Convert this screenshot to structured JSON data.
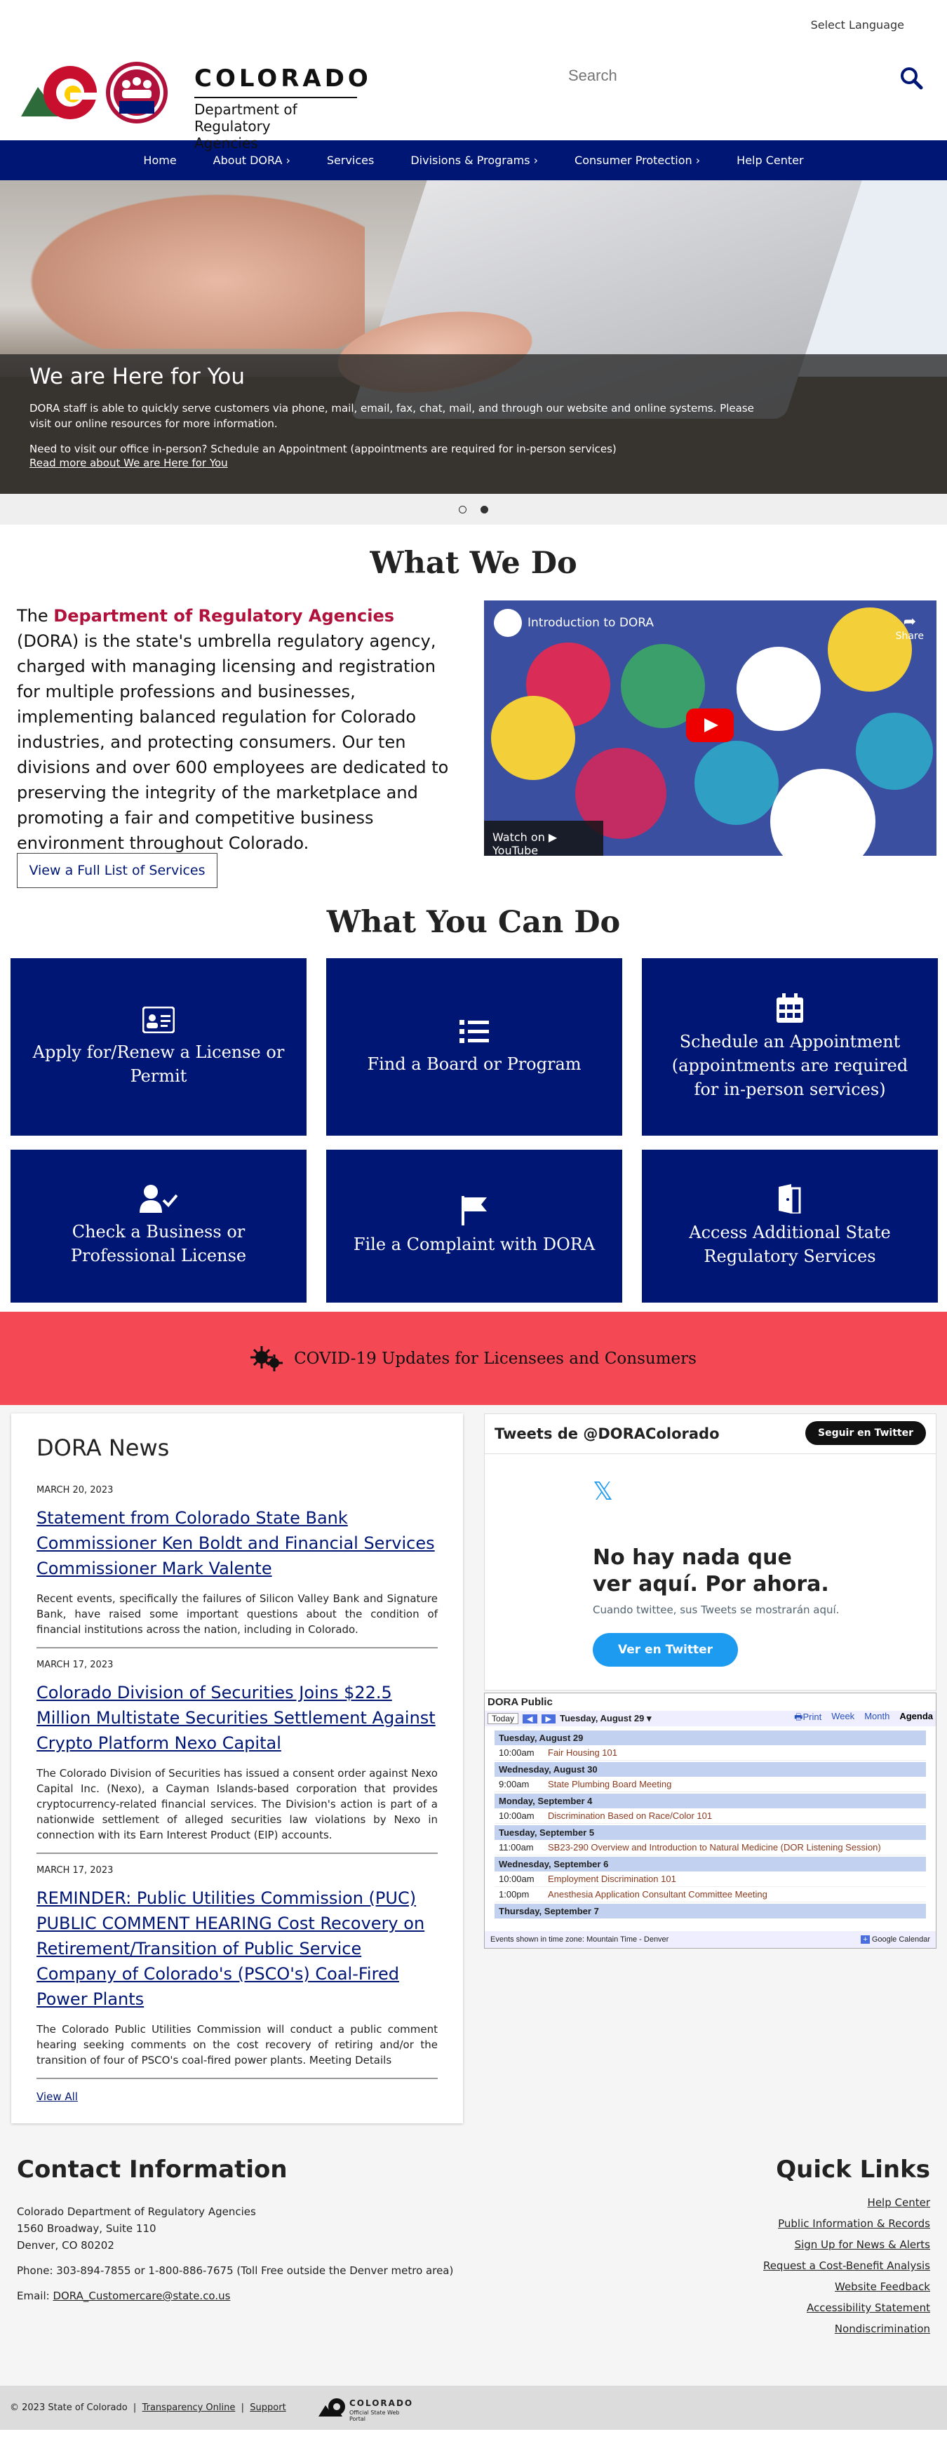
{
  "top": {
    "language": "Select Language"
  },
  "header": {
    "state_word": "COLORADO",
    "dept_line1": "Department of",
    "dept_line2": "Regulatory Agencies",
    "seal_text": "DORA",
    "search_placeholder": "Search"
  },
  "nav": {
    "items": [
      "Home",
      "About DORA ›",
      "Services",
      "Divisions & Programs ›",
      "Consumer Protection ›",
      "Help Center"
    ]
  },
  "hero": {
    "title": "We are Here for You",
    "para1": "DORA staff is able to quickly serve customers via phone, mail, email, fax, chat, mail, and through our website and online systems. Please visit our online resources for more information.",
    "para2": "Need to visit our office in-person? Schedule an Appointment (appointments are required for in-person services)",
    "link": "Read more about We are Here for You"
  },
  "what_we_do": {
    "heading": "What We Do",
    "lead": "The ",
    "dept_name": "Department of Regulatory Agencies",
    "body": " (DORA) is the state's umbrella regulatory agency, charged with managing licensing and registration for multiple professions and businesses, implementing balanced regulation for Colorado industries, and protecting consumers. Our ten divisions and over 600 employees are dedicated to preserving the integrity of the marketplace and promoting a fair and competitive business environment throughout Colorado.",
    "button": "View a Full List of Services",
    "video_title": "Introduction to DORA",
    "video_share": "Share",
    "video_watch": "Watch on ▶ YouTube"
  },
  "what_you_can_do": {
    "heading": "What You Can Do",
    "cards": [
      {
        "label": "Apply for/Renew a License or Permit",
        "icon": "id-card-icon"
      },
      {
        "label": "Find a Board or Program",
        "icon": "list-icon"
      },
      {
        "label": "Schedule an Appointment (appointments are required for in-person services)",
        "icon": "calendar-icon"
      },
      {
        "label": "Check a Business or Professional License",
        "icon": "user-check-icon"
      },
      {
        "label": "File a Complaint with DORA",
        "icon": "flag-icon"
      },
      {
        "label": "Access Additional State Regulatory Services",
        "icon": "door-icon"
      }
    ]
  },
  "covid": {
    "label": "COVID-19 Updates for Licensees and Consumers"
  },
  "news": {
    "heading": "DORA News",
    "items": [
      {
        "date": "MARCH 20, 2023",
        "title": "Statement from Colorado State Bank Commissioner Ken Boldt and Financial Services Commissioner Mark Valente",
        "body": "Recent events, specifically the failures of Silicon Valley Bank and Signature Bank, have raised some important questions about the condition of financial institutions across the nation, including in Colorado."
      },
      {
        "date": "MARCH 17, 2023",
        "title": "Colorado Division of Securities Joins $22.5 Million Multistate Securities Settlement Against Crypto Platform Nexo Capital",
        "body": "The Colorado Division of Securities has issued a consent order against Nexo Capital Inc. (Nexo), a Cayman Islands-based corporation that provides cryptocurrency-related financial services. The Division's action is part of a nationwide settlement of alleged securities law violations by Nexo in connection with its Earn Interest Product (EIP) accounts."
      },
      {
        "date": "MARCH 17, 2023",
        "title": "REMINDER: Public Utilities Commission (PUC) PUBLIC COMMENT HEARING Cost Recovery on Retirement/Transition of Public Service Company of Colorado's (PSCO's) Coal-Fired Power Plants",
        "body": "The Colorado Public Utilities Commission will conduct a public comment hearing seeking comments on the cost recovery of retiring and/or the transition of four of PSCO's coal-fired power plants. Meeting Details"
      }
    ],
    "view_all": "View All"
  },
  "twitter": {
    "title": "Tweets de @DORAColorado",
    "follow": "Seguir en Twitter",
    "empty": "No hay nada que ver aquí. Por ahora.",
    "sub": "Cuando twittee, sus Tweets se mostrarán aquí.",
    "view": "Ver en Twitter"
  },
  "calendar": {
    "title": "DORA Public",
    "today": "Today",
    "prev": "◀",
    "next": "▶",
    "range": "Tuesday, August 29 ▾",
    "print": "Print",
    "week": "Week",
    "month": "Month",
    "agenda": "Agenda",
    "days": [
      {
        "day": "Tuesday, August 29",
        "events": [
          {
            "time": "10:00am",
            "name": "Fair Housing 101"
          }
        ]
      },
      {
        "day": "Wednesday, August 30",
        "events": [
          {
            "time": "9:00am",
            "name": "State Plumbing Board Meeting"
          }
        ]
      },
      {
        "day": "Monday, September 4",
        "events": [
          {
            "time": "10:00am",
            "name": "Discrimination Based on Race/Color 101"
          }
        ]
      },
      {
        "day": "Tuesday, September 5",
        "events": [
          {
            "time": "11:00am",
            "name": "SB23-290 Overview and Introduction to Natural Medicine (DOR Listening Session)"
          }
        ]
      },
      {
        "day": "Wednesday, September 6",
        "events": [
          {
            "time": "10:00am",
            "name": "Employment Discrimination 101"
          },
          {
            "time": "1:00pm",
            "name": "Anesthesia Application Consultant Committee Meeting"
          }
        ]
      },
      {
        "day": "Thursday, September 7",
        "events": []
      }
    ],
    "tz": "Events shown in time zone: Mountain Time - Denver",
    "gcal": "Google Calendar"
  },
  "contact": {
    "heading": "Contact Information",
    "line1": "Colorado Department of Regulatory Agencies",
    "line2": "1560 Broadway, Suite 110",
    "line3": "Denver, CO 80202",
    "phone": "Phone: 303-894-7855 or 1-800-886-7675 (Toll Free outside the Denver metro area)",
    "email_label": "Email: ",
    "email": "DORA_Customercare@state.co.us"
  },
  "quick_links": {
    "heading": "Quick Links",
    "links": [
      "Help Center",
      "Public Information & Records",
      "Sign Up for News & Alerts",
      "Request a Cost-Benefit Analysis",
      "Website Feedback",
      "Accessibility Statement",
      "Nondiscrimination"
    ]
  },
  "footer": {
    "copyright": "© 2023 State of Colorado",
    "transparency": "Transparency Online",
    "support": "Support",
    "logo_word": "COLORADO",
    "logo_sub": "Official State Web Portal"
  }
}
